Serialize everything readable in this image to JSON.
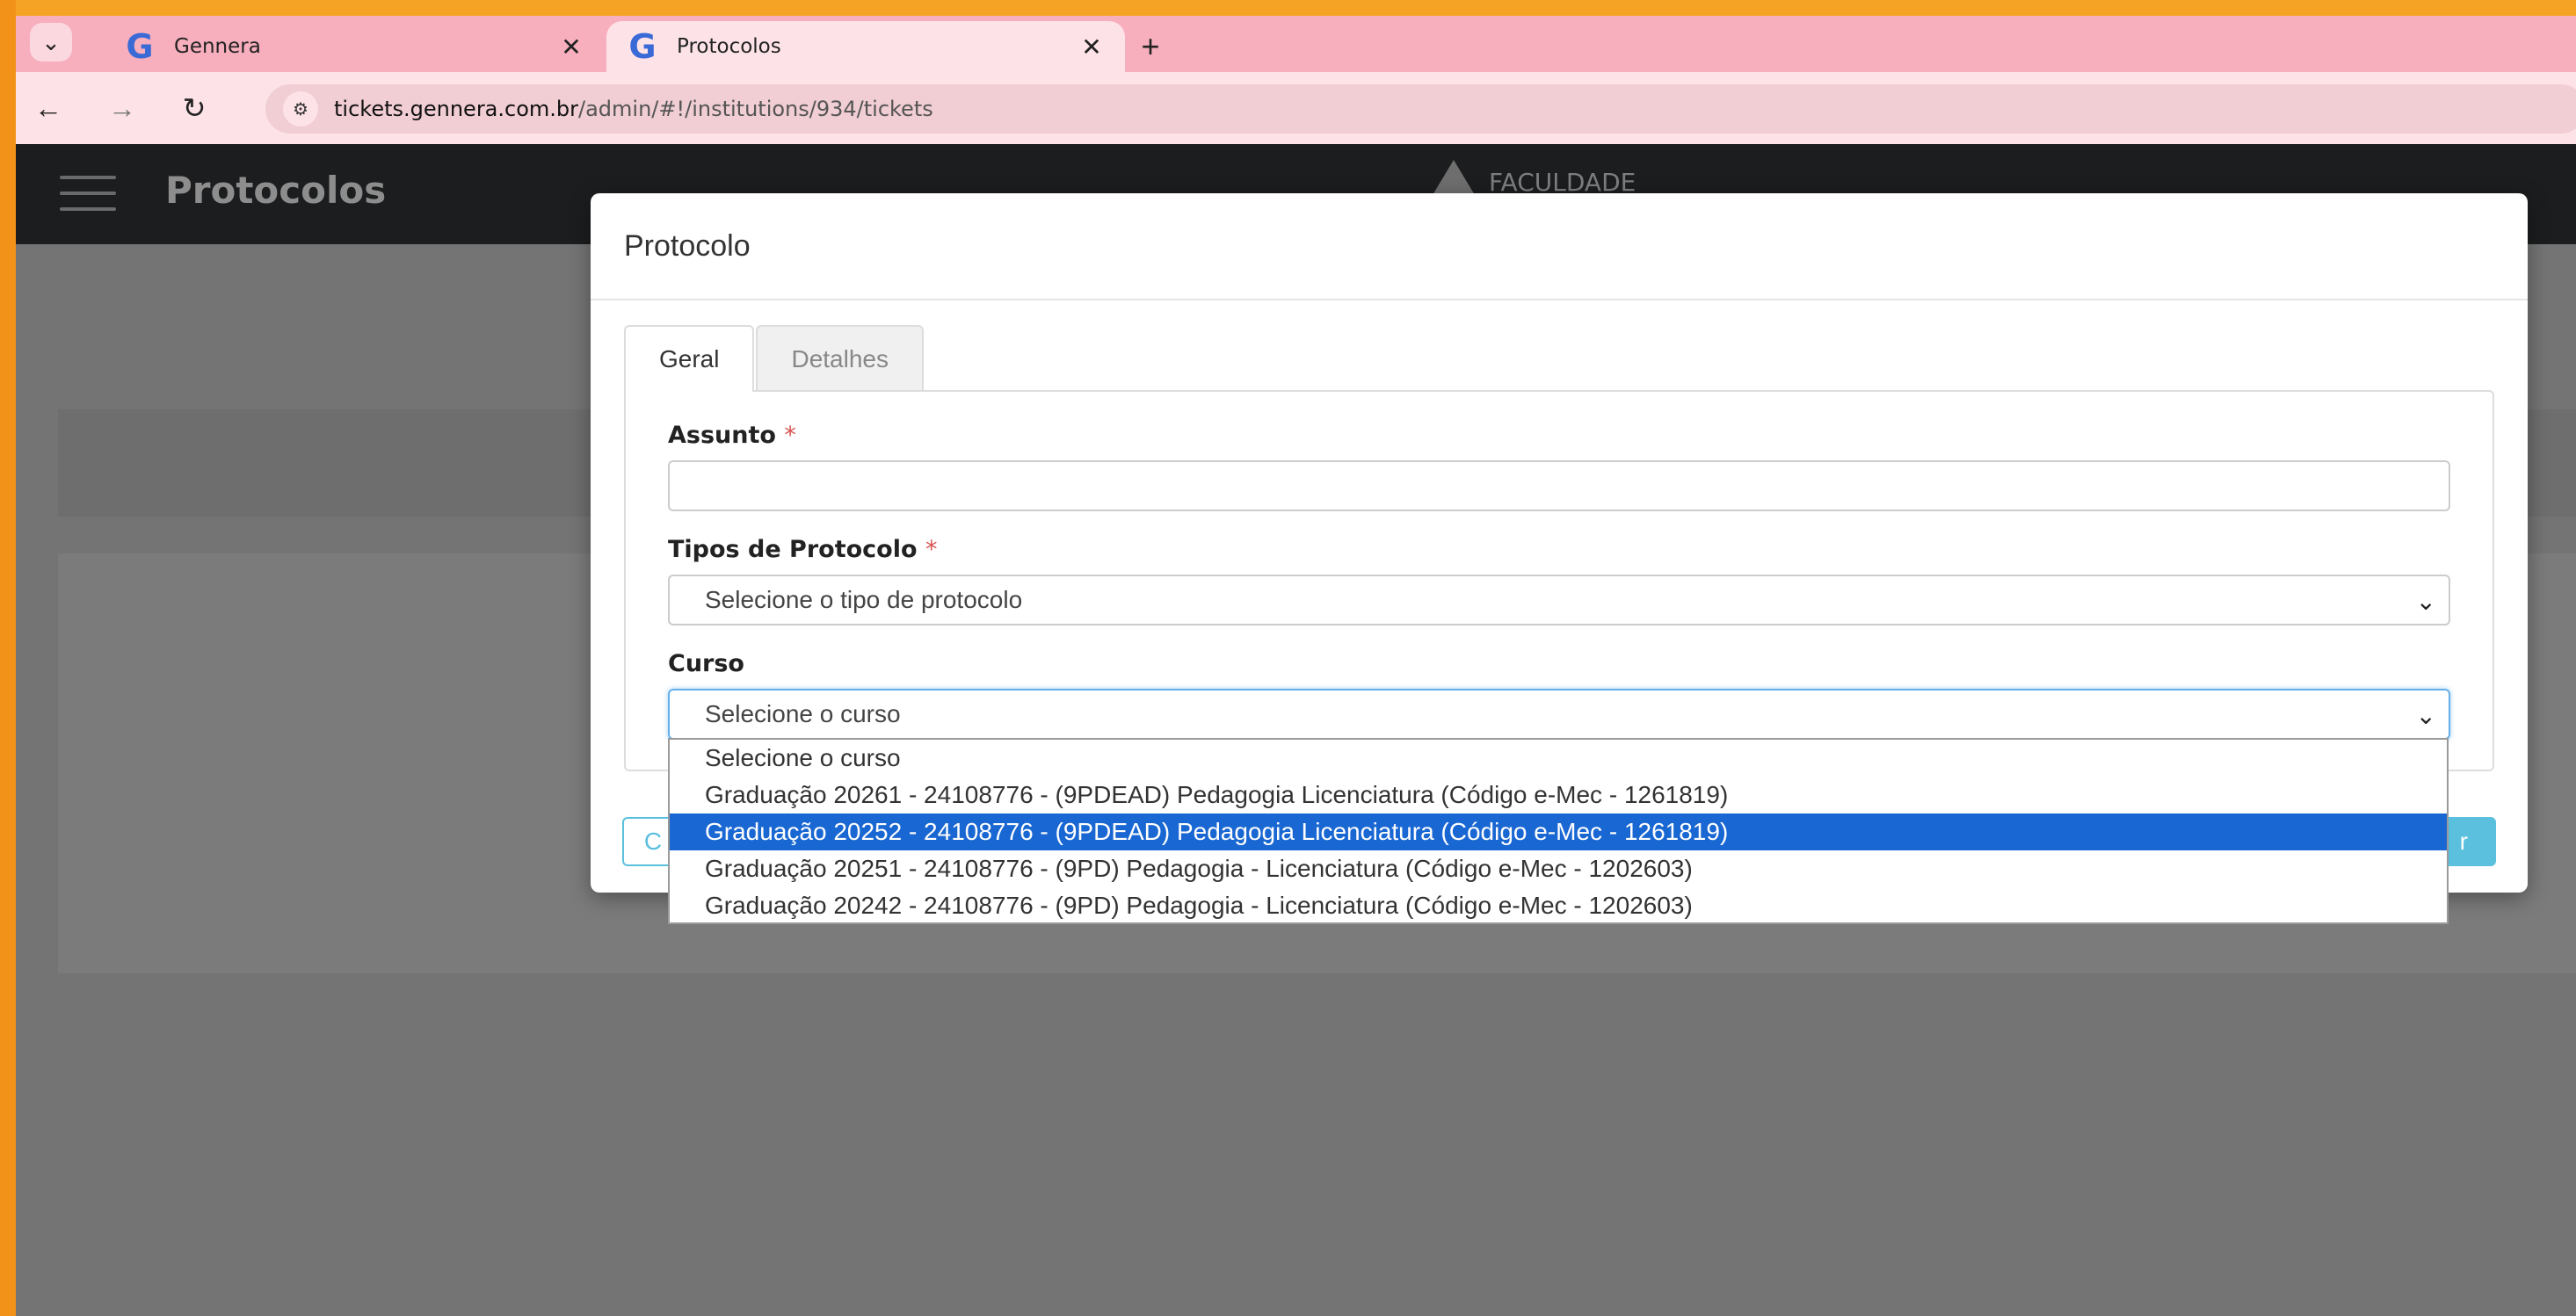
{
  "browser": {
    "tabs": [
      {
        "title": "Gennera",
        "active": false,
        "icon": "google-g-icon"
      },
      {
        "title": "Protocolos",
        "active": true,
        "icon": "google-g-icon"
      }
    ],
    "url_host": "tickets.gennera.com.br",
    "url_path": "/admin/#!/institutions/934/tickets"
  },
  "app": {
    "title": "Protocolos",
    "brand": "FACULDADE"
  },
  "modal": {
    "title": "Protocolo",
    "tabs": [
      {
        "label": "Geral",
        "active": true
      },
      {
        "label": "Detalhes",
        "active": false
      }
    ],
    "fields": {
      "assunto_label": "Assunto",
      "assunto_value": "",
      "tipos_label": "Tipos de Protocolo",
      "tipos_value": "Selecione o tipo de protocolo",
      "curso_label": "Curso",
      "curso_value": "Selecione o curso",
      "required_mark": "*"
    },
    "footer": {
      "left_button": "C",
      "right_button": "r"
    }
  },
  "dropdown": {
    "options": [
      "Selecione o curso",
      "Graduação 20261 - 24108776 - (9PDEAD) Pedagogia Licenciatura (Código e-Mec - 1261819)",
      "Graduação 20252 - 24108776 - (9PDEAD) Pedagogia Licenciatura (Código e-Mec - 1261819)",
      "Graduação 20251 - 24108776 - (9PD) Pedagogia - Licenciatura (Código e-Mec - 1202603)",
      "Graduação 20242 - 24108776 - (9PD) Pedagogia - Licenciatura (Código e-Mec - 1202603)"
    ],
    "selected_index": 2
  },
  "colors": {
    "frame": "#f39a1e",
    "tabbar": "#f7aebd",
    "selected_option": "#1967d2",
    "info_button": "#5bc0de"
  }
}
